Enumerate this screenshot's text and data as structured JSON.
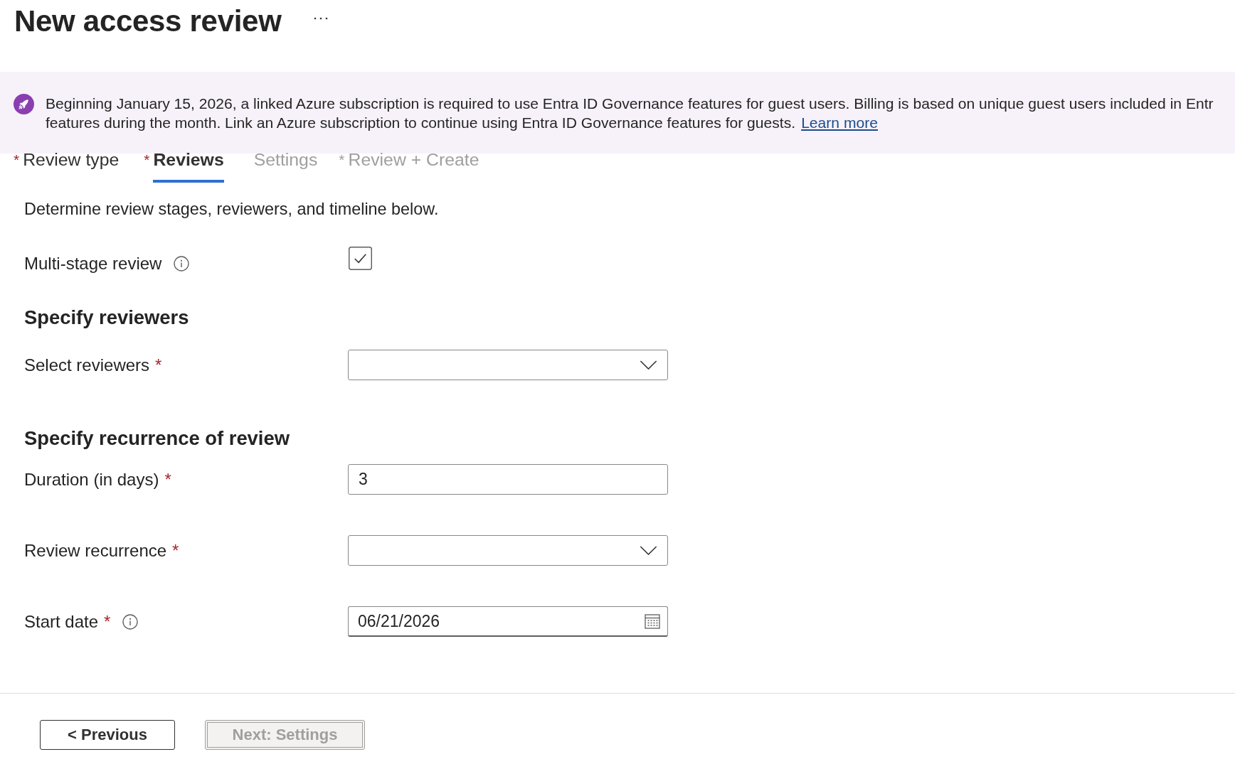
{
  "page": {
    "title": "New access review"
  },
  "banner": {
    "lines": [
      "Beginning January 15, 2026, a linked Azure subscription is required to use Entra ID Governance features for guest users. Billing is based on unique guest users included in Entr",
      "features during the month. Link an Azure subscription to continue using Entra ID Governance features for guests."
    ],
    "link": "Learn more"
  },
  "tabs": [
    {
      "required_mark": "*",
      "label": "Review type",
      "selected": false,
      "disabled": false
    },
    {
      "required_mark": "*",
      "label": "Reviews",
      "selected": true,
      "disabled": false
    },
    {
      "label": "Settings",
      "selected": false,
      "disabled": true
    },
    {
      "required_mark": "*",
      "label": "Review + Create",
      "selected": false,
      "disabled": true
    }
  ],
  "intro": "Determine review stages, reviewers, and timeline below.",
  "form": [
    {
      "kind": "checkbox",
      "label": "Multi-stage review",
      "info": true,
      "checked": true
    },
    {
      "kind": "heading",
      "label": "Specify reviewers"
    },
    {
      "kind": "dropdown",
      "label": "Select reviewers",
      "required_mark": "*",
      "info": false
    },
    {
      "kind": "heading",
      "label": "Specify recurrence of review"
    },
    {
      "kind": "text",
      "label": "Duration (in days)",
      "required_mark": "*",
      "info": false,
      "value": "3"
    },
    {
      "kind": "dropdown",
      "label": "Review recurrence",
      "required_mark": "*",
      "info": false
    },
    {
      "kind": "date",
      "label": "Start date",
      "required_mark": "*",
      "info": true,
      "value": "06/21/2026"
    }
  ],
  "footer": {
    "buttons": [
      {
        "label": "< Previous",
        "disabled": false
      },
      {
        "label": "Next: Settings",
        "disabled": true
      }
    ]
  }
}
